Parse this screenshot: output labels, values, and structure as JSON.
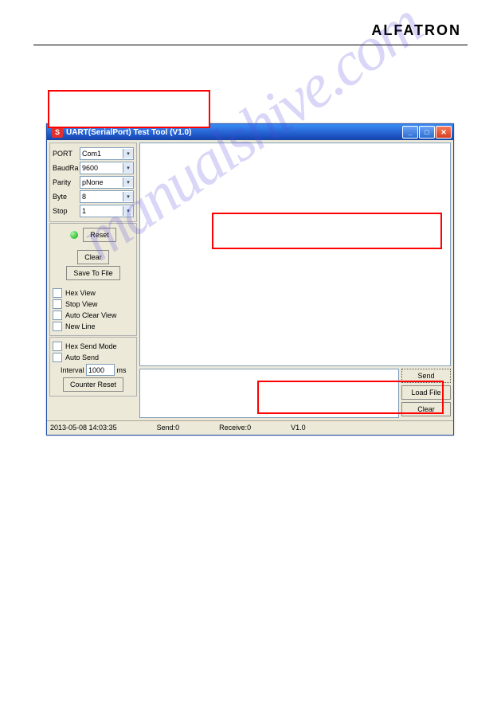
{
  "brand": "ALFATRON",
  "watermark": "manualshive.com",
  "window": {
    "title": "UART(SerialPort) Test Tool (V1.0)"
  },
  "port_section": {
    "labels": {
      "port": "PORT",
      "baud": "BaudRa",
      "parity": "Parity",
      "byte": "Byte",
      "stop": "Stop"
    },
    "values": {
      "port": "Com1",
      "baud": "9600",
      "parity": "pNone",
      "byte": "8",
      "stop": "1"
    }
  },
  "buttons": {
    "reset": "Reset",
    "clear": "Clear",
    "save": "Save To File",
    "send": "Send",
    "load": "Load File",
    "clear2": "Clear",
    "counter": "Counter Reset"
  },
  "checks": {
    "hexview": "Hex View",
    "stopview": "Stop View",
    "autoclear": "Auto Clear View",
    "newline": "New Line",
    "hexsend": "Hex Send Mode",
    "autosend": "Auto Send"
  },
  "interval": {
    "label": "Interval",
    "value": "1000",
    "unit": "ms"
  },
  "status": {
    "ts": "2013-05-08 14:03:35",
    "send": "Send:0",
    "recv": "Receive:0",
    "ver": "V1.0"
  }
}
